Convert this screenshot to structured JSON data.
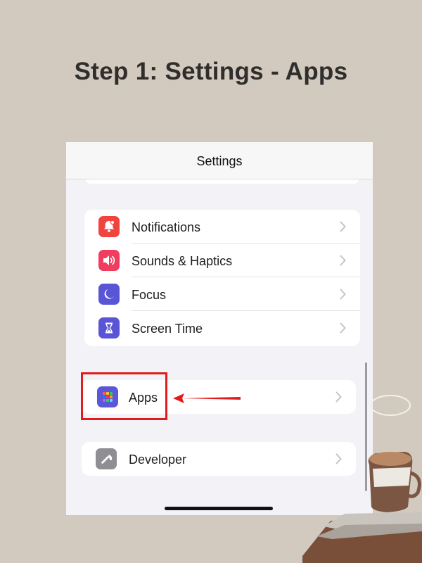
{
  "heading": "Step 1: Settings - Apps",
  "nav": {
    "title": "Settings"
  },
  "group1": [
    {
      "label": "Notifications",
      "icon": "notifications-bell-icon",
      "color": "#f0443f"
    },
    {
      "label": "Sounds & Haptics",
      "icon": "speaker-icon",
      "color": "#f03c5e"
    },
    {
      "label": "Focus",
      "icon": "moon-icon",
      "color": "#5a55d6"
    },
    {
      "label": "Screen Time",
      "icon": "hourglass-icon",
      "color": "#5a55d6"
    }
  ],
  "apps": {
    "label": "Apps",
    "icon": "apps-grid-icon",
    "color": "#5b57d8"
  },
  "developer": {
    "label": "Developer",
    "icon": "hammer-icon",
    "color": "#8e8e93"
  },
  "colors": {
    "highlight": "#e21c1c",
    "background": "#d2cabf"
  }
}
